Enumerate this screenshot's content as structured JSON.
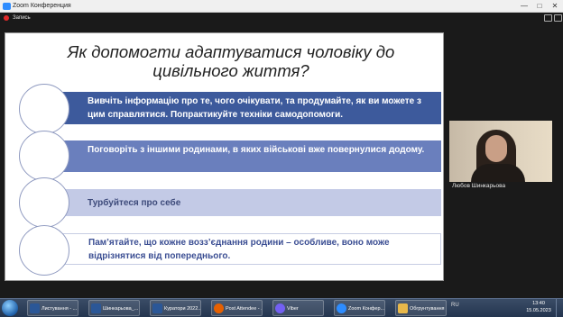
{
  "window": {
    "title": "Zoom Конференция",
    "controls": {
      "minimize": "—",
      "maximize": "□",
      "close": "✕"
    }
  },
  "recording": {
    "label": "Запись"
  },
  "slide": {
    "title": "Як допомогти адаптуватися чоловіку до цивільного життя?",
    "items": [
      {
        "text": "Вивчіть інформацію про те, чого очікувати, та продумайте, як ви можете з цим справлятися. Попрактикуйте техніки самодопомоги."
      },
      {
        "text": "Поговоріть з іншими родинами, в яких військові вже повернулися додому."
      },
      {
        "text": "Турбуйтеся про себе"
      },
      {
        "text": "Пам’ятайте, що кожне возз’єднання родини – особливе, воно може відрізнятися від попереднього."
      }
    ]
  },
  "participant": {
    "name": "Любов Шинкарьова"
  },
  "taskbar": {
    "apps": [
      {
        "label": "Листування - ...",
        "icon": "word-icon",
        "color": "#2b5797"
      },
      {
        "label": "Шинкарьова_...",
        "icon": "word-icon",
        "color": "#2b5797"
      },
      {
        "label": "Куратори 2022...",
        "icon": "word-icon",
        "color": "#2b5797"
      },
      {
        "label": "Post Attendee - ...",
        "icon": "firefox-icon",
        "color": "#e66000"
      },
      {
        "label": "Viber",
        "icon": "viber-icon",
        "color": "#7360f2"
      },
      {
        "label": "Zoom Конфер...",
        "icon": "zoom-icon",
        "color": "#2d8cff"
      },
      {
        "label": "Обгрунтування",
        "icon": "folder-icon",
        "color": "#e8b84a"
      }
    ],
    "language": "RU",
    "time": "13:40",
    "date": "15.05.2023"
  }
}
